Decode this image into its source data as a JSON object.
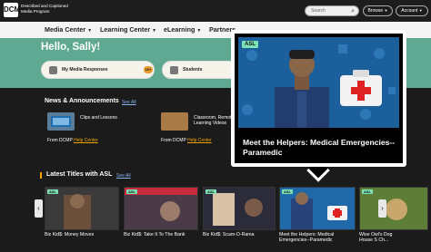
{
  "header": {
    "logo_glyph": "DCMP",
    "logo_text": "Described and Captioned Media Program",
    "search_placeholder": "Search",
    "browse_label": "Browse",
    "account_label": "Account",
    "caret": "▼"
  },
  "nav": {
    "items": [
      {
        "label": "Media Center"
      },
      {
        "label": "Learning Center"
      },
      {
        "label": "eLearning"
      },
      {
        "label": "Partners"
      }
    ]
  },
  "hero": {
    "greeting": "Hello, Sally!",
    "cards": [
      {
        "label": "My Media Responses",
        "badge": "10+"
      },
      {
        "label": "Students"
      }
    ]
  },
  "news": {
    "title": "News & Announcements",
    "see_all": "See All",
    "items": [
      {
        "title": "Clips and Lessons",
        "from_prefix": "From DCMP",
        "link": "Help Center"
      },
      {
        "title": "Classroom, Remote Learning Videos",
        "from_prefix": "From DCMP",
        "link": "Help Center"
      }
    ]
  },
  "latest": {
    "title": "Latest Titles with ASL",
    "see_all": "See All",
    "tiles": [
      {
        "tag": "ASL",
        "label": "Biz Kid$: Money Moves"
      },
      {
        "tag": "ASL",
        "label": "Biz Kid$: Take It To The Bank"
      },
      {
        "tag": "ASL",
        "label": "Biz Kid$: Scam-O-Rama"
      },
      {
        "tag": "ASL",
        "label_line1": "Meet the Helpers: Medical",
        "label_line2": "Emergencies--Paramedic"
      },
      {
        "tag": "ASL",
        "label_line1": "Wise Owl's Dog",
        "label_line2": "House S Ch..."
      }
    ]
  },
  "popup": {
    "tag": "ASL",
    "title": "Meet the Helpers: Medical Emergencies--Paramedic"
  },
  "colors": {
    "accent": "#f0a500",
    "hero": "#5fa992",
    "asl_tag": "#7de2b5"
  },
  "icons": {
    "search": "magnifier-icon",
    "next": "chevron-right-icon",
    "prev": "chevron-left-icon"
  }
}
